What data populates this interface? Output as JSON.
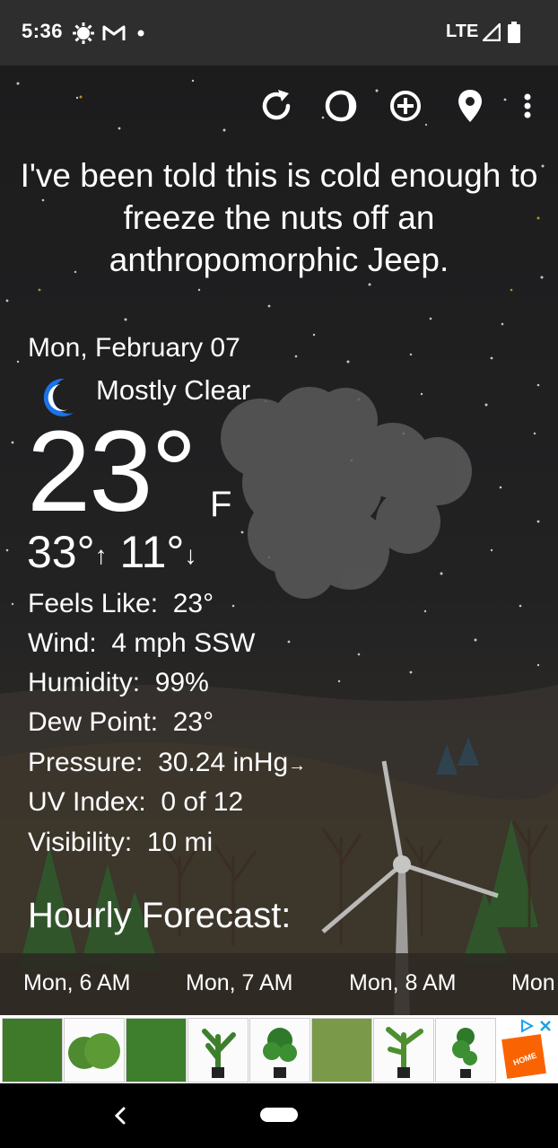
{
  "status_bar": {
    "time": "5:36",
    "network": "LTE",
    "icons": [
      "sun-settings-icon",
      "gmail-icon",
      "notification-dot-icon",
      "signal-icon",
      "battery-icon"
    ]
  },
  "toolbar": {
    "icons": [
      "refresh-icon",
      "theme-icon",
      "add-location-icon",
      "location-pin-icon",
      "more-options-icon"
    ]
  },
  "quote": "I've been told this is cold enough to freeze the nuts off an anthropomorphic Jeep.",
  "current": {
    "date": "Mon, February 07",
    "condition": "Mostly Clear",
    "condition_icon": "crescent-moon-icon",
    "temperature": "23°",
    "unit": "F",
    "high": "33°",
    "low": "11°"
  },
  "details": [
    {
      "label": "Feels Like:",
      "value": "23°"
    },
    {
      "label": "Wind:",
      "value": "4 mph SSW"
    },
    {
      "label": "Humidity:",
      "value": "99%"
    },
    {
      "label": "Dew Point:",
      "value": "23°"
    },
    {
      "label": "Pressure:",
      "value": "30.24 inHg",
      "trend": "→"
    },
    {
      "label": "UV Index:",
      "value": "0 of 12"
    },
    {
      "label": "Visibility:",
      "value": "10 mi"
    }
  ],
  "hourly": {
    "title": "Hourly Forecast:",
    "hours": [
      "Mon, 6 AM",
      "Mon, 7 AM",
      "Mon, 8 AM",
      "Mon"
    ]
  },
  "colors": {
    "accent_moon": "#1a73e8",
    "background": "#1f1f20",
    "ad_brand": "#f96302"
  },
  "ad": {
    "brand": "THE HOME DEPOT"
  },
  "nav": {
    "icons": [
      "back-icon",
      "home-pill-icon"
    ]
  }
}
